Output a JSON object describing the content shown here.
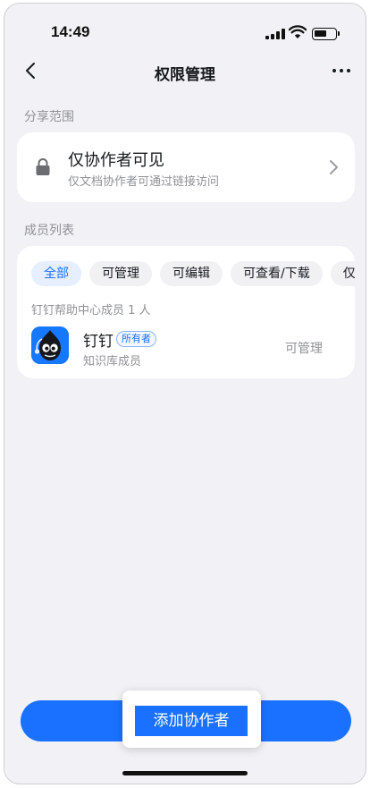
{
  "status_bar": {
    "time": "14:49"
  },
  "nav": {
    "title": "权限管理"
  },
  "share_scope": {
    "section_label": "分享范围",
    "title": "仅协作者可见",
    "description": "仅文档协作者可通过链接访问"
  },
  "members": {
    "section_label": "成员列表",
    "filters": [
      "全部",
      "可管理",
      "可编辑",
      "可查看/下载",
      "仅"
    ],
    "active_filter": "全部",
    "count_text": "钉钉帮助中心成员 1 人",
    "items": [
      {
        "name": "钉钉",
        "badge": "所有者",
        "role": "知识库成员",
        "permission": "可管理"
      }
    ]
  },
  "actions": {
    "add_collaborator": "添加协作者"
  },
  "colors": {
    "accent": "#1a71ff",
    "background": "#f2f2f6"
  }
}
